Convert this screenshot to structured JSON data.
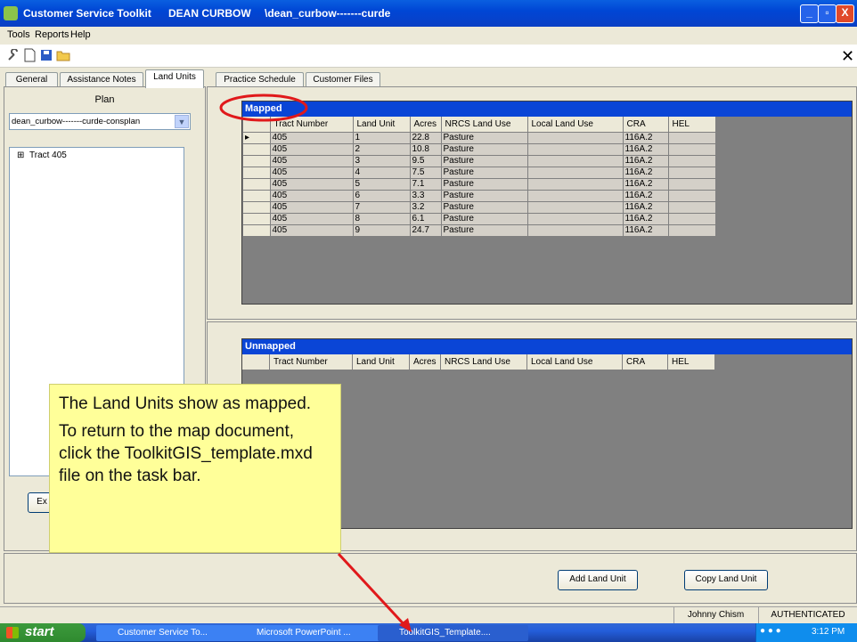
{
  "window": {
    "title_app": "Customer Service Toolkit",
    "title_user": "DEAN CURBOW",
    "title_path": "\\dean_curbow-------curde",
    "btn_min": "_",
    "btn_max": "▫",
    "btn_close": "X"
  },
  "menu": [
    "Tools",
    "Reports",
    "Help"
  ],
  "toolbar": {
    "close_glyph": "✕"
  },
  "tabs": [
    "General",
    "Assistance Notes",
    "Land Units",
    "Practice Schedule",
    "Customer Files"
  ],
  "left": {
    "plan_label": "Plan",
    "plan_select": "dean_curbow-------curde-consplan",
    "tree_expand": "⊞",
    "tree_item": "Tract 405",
    "partial_button": "Ex"
  },
  "mapped": {
    "header": "Mapped",
    "columns": [
      "Tract Number",
      "Land Unit",
      "Acres",
      "NRCS Land Use",
      "Local Land Use",
      "CRA",
      "HEL"
    ],
    "rows": [
      [
        "405",
        "1",
        "22.8",
        "Pasture",
        "",
        "116A.2",
        ""
      ],
      [
        "405",
        "2",
        "10.8",
        "Pasture",
        "",
        "116A.2",
        ""
      ],
      [
        "405",
        "3",
        "9.5",
        "Pasture",
        "",
        "116A.2",
        ""
      ],
      [
        "405",
        "4",
        "7.5",
        "Pasture",
        "",
        "116A.2",
        ""
      ],
      [
        "405",
        "5",
        "7.1",
        "Pasture",
        "",
        "116A.2",
        ""
      ],
      [
        "405",
        "6",
        "3.3",
        "Pasture",
        "",
        "116A.2",
        ""
      ],
      [
        "405",
        "7",
        "3.2",
        "Pasture",
        "",
        "116A.2",
        ""
      ],
      [
        "405",
        "8",
        "6.1",
        "Pasture",
        "",
        "116A.2",
        ""
      ],
      [
        "405",
        "9",
        "24.7",
        "Pasture",
        "",
        "116A.2",
        ""
      ]
    ],
    "row_marker": "▸"
  },
  "unmapped": {
    "header": "Unmapped",
    "columns": [
      "Tract Number",
      "Land Unit",
      "Acres",
      "NRCS Land Use",
      "Local Land Use",
      "CRA",
      "HEL"
    ]
  },
  "buttons": {
    "add": "Add Land Unit",
    "copy": "Copy Land Unit"
  },
  "callout": {
    "line1": "The Land Units show as mapped.",
    "line2": "To return to the map document, click the ToolkitGIS_template.mxd file on the task bar."
  },
  "status": {
    "user": "Johnny Chism",
    "auth": "AUTHENTICATED"
  },
  "taskbar": {
    "start": "start",
    "items": [
      "Customer Service To...",
      "Microsoft PowerPoint ...",
      "ToolkitGIS_Template...."
    ],
    "clock": "3:12 PM"
  },
  "colors": {
    "titlebar": "#0046d5",
    "annotation": "#e0191b",
    "callout": "#ffff99"
  }
}
